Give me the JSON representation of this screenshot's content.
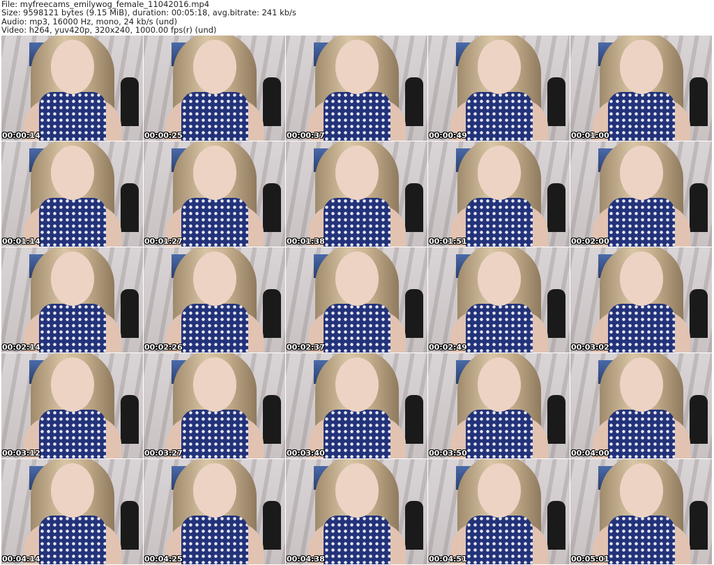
{
  "header": {
    "file": "File: myfreecams_emilywog_female_11042016.mp4",
    "size": "Size: 9598121 bytes (9.15 MiB), duration: 00:05:18, avg.bitrate: 241 kb/s",
    "audio": "Audio: mp3, 16000 Hz, mono, 24 kb/s (und)",
    "video": "Video: h264, yuv420p, 320x240, 1000.00 fps(r) (und)"
  },
  "thumbnails": [
    {
      "time": "00:00:14"
    },
    {
      "time": "00:00:25"
    },
    {
      "time": "00:00:37"
    },
    {
      "time": "00:00:49"
    },
    {
      "time": "00:01:00"
    },
    {
      "time": "00:01:14"
    },
    {
      "time": "00:01:27"
    },
    {
      "time": "00:01:38"
    },
    {
      "time": "00:01:51"
    },
    {
      "time": "00:02:00"
    },
    {
      "time": "00:02:14"
    },
    {
      "time": "00:02:26"
    },
    {
      "time": "00:02:37"
    },
    {
      "time": "00:02:49"
    },
    {
      "time": "00:03:02"
    },
    {
      "time": "00:03:12"
    },
    {
      "time": "00:03:27"
    },
    {
      "time": "00:03:40"
    },
    {
      "time": "00:03:50"
    },
    {
      "time": "00:04:00"
    },
    {
      "time": "00:04:14"
    },
    {
      "time": "00:04:25"
    },
    {
      "time": "00:04:38"
    },
    {
      "time": "00:04:51"
    },
    {
      "time": "00:05:01"
    }
  ]
}
